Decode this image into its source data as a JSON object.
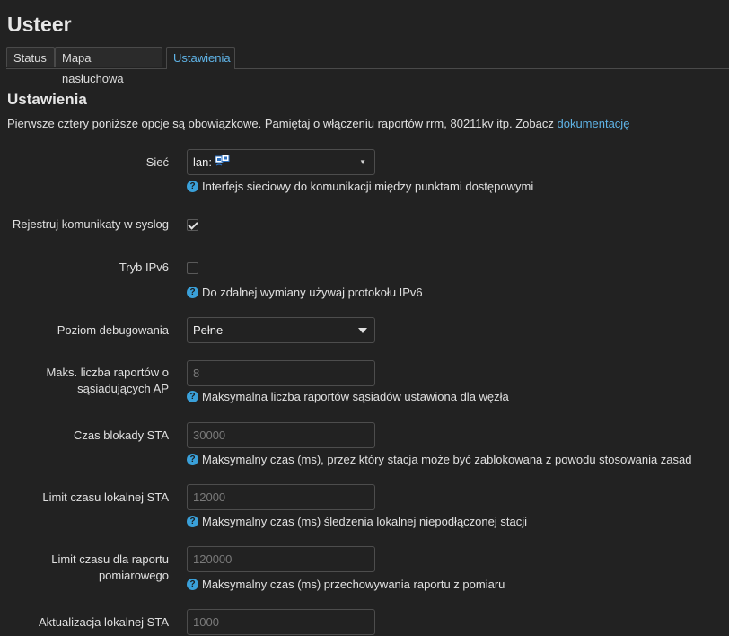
{
  "app_title": "Usteer",
  "tabs": [
    {
      "label": "Status",
      "active": false
    },
    {
      "label": "Mapa nasłuchowa",
      "active": false
    },
    {
      "label": "Ustawienia",
      "active": true
    }
  ],
  "section_title": "Ustawienia",
  "intro": {
    "text": "Pierwsze cztery poniższe opcje są obowiązkowe. Pamiętaj o włączeniu raportów rrm, 80211kv itp. Zobacz ",
    "link": "dokumentację"
  },
  "fields": {
    "network": {
      "label": "Sieć",
      "value": "lan:",
      "icon": "network-interface-icon",
      "help": "Interfejs sieciowy do komunikacji między punktami dostępowymi"
    },
    "syslog": {
      "label": "Rejestruj komunikaty w syslog",
      "checked": true
    },
    "ipv6": {
      "label": "Tryb IPv6",
      "checked": false,
      "help": "Do zdalnej wymiany używaj protokołu IPv6"
    },
    "debug_level": {
      "label": "Poziom debugowania",
      "value": "Pełne"
    },
    "max_neighbor_reports": {
      "label": "Maks. liczba raportów o sąsiadujących AP",
      "placeholder": "8",
      "help": "Maksymalna liczba raportów sąsiadów ustawiona dla węzła"
    },
    "sta_block_timeout": {
      "label": "Czas blokady STA",
      "placeholder": "30000",
      "help": "Maksymalny czas (ms), przez który stacja może być zablokowana z powodu stosowania zasad"
    },
    "local_sta_timeout": {
      "label": "Limit czasu lokalnej STA",
      "placeholder": "12000",
      "help": "Maksymalny czas (ms) śledzenia lokalnej niepodłączonej stacji"
    },
    "measurement_report_timeout": {
      "label": "Limit czasu dla raportu pomiarowego",
      "placeholder": "120000",
      "help": "Maksymalny czas (ms) przechowywania raportu z pomiaru"
    },
    "local_sta_update": {
      "label": "Aktualizacja lokalnej STA",
      "placeholder": "1000"
    }
  },
  "colors": {
    "background": "#222222",
    "accent": "#5fb3e6",
    "help_icon": "#3aa0d9"
  }
}
